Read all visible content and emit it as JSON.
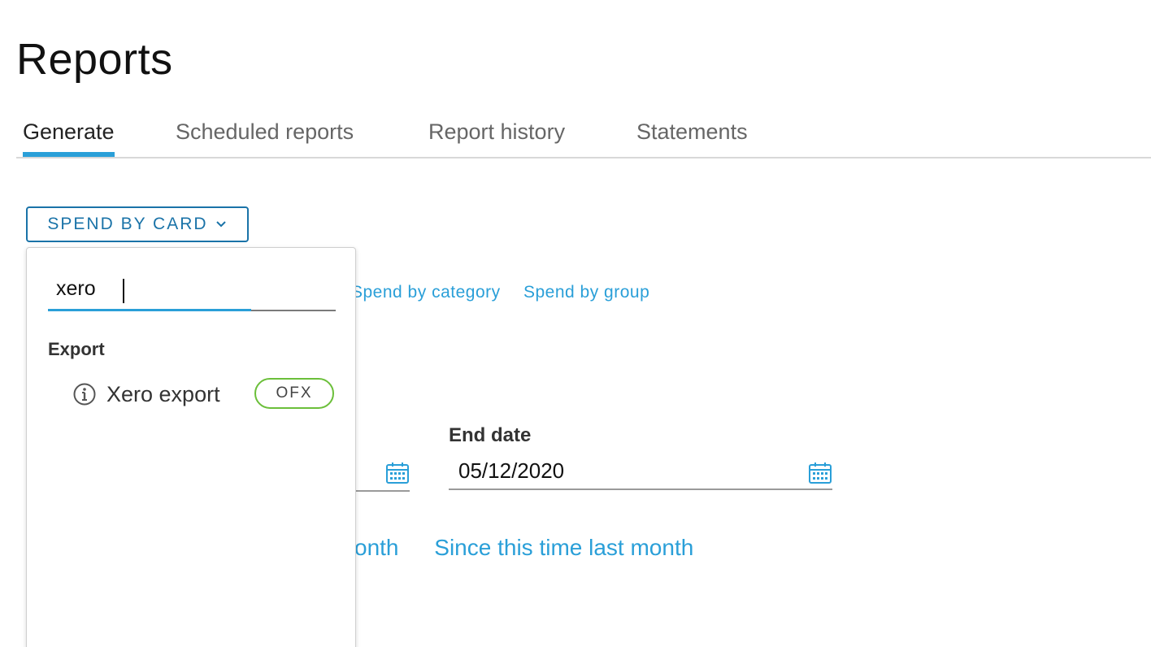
{
  "page": {
    "title": "Reports"
  },
  "tabs": [
    {
      "label": "Generate",
      "active": true
    },
    {
      "label": "Scheduled reports",
      "active": false
    },
    {
      "label": "Report history",
      "active": false
    },
    {
      "label": "Statements",
      "active": false
    }
  ],
  "report_selector": {
    "label": "SPEND BY CARD"
  },
  "report_links": [
    {
      "label": "Spend by category"
    },
    {
      "label": "Spend by group"
    }
  ],
  "date_range": {
    "end_label": "End date",
    "end_value": "05/12/2020"
  },
  "quick_ranges": [
    {
      "label": "onth"
    },
    {
      "label": "Since this time last month"
    }
  ],
  "dropdown_panel": {
    "search_value": "xero",
    "group_label": "Export",
    "results": [
      {
        "label": "Xero export",
        "badge": "OFX",
        "icon": "info-icon"
      }
    ]
  },
  "colors": {
    "accent": "#2a9fd8",
    "button_border": "#1a73a8",
    "badge_border": "#6bbf3a"
  }
}
